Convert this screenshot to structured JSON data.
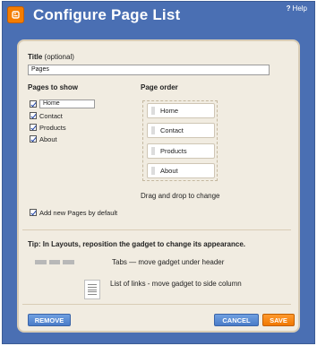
{
  "window": {
    "title": "Configure Page List",
    "help_label": "Help",
    "help_icon": "?",
    "logo_icon": "blogger-icon"
  },
  "form": {
    "title_label": "Title",
    "title_optional": "(optional)",
    "title_value": "Pages",
    "pages_to_show_label": "Pages to show",
    "pages": [
      {
        "label": "Home",
        "checked": true
      },
      {
        "label": "Contact",
        "checked": true
      },
      {
        "label": "Products",
        "checked": true
      },
      {
        "label": "About",
        "checked": true
      }
    ],
    "page_order_label": "Page order",
    "page_order": [
      "Home",
      "Contact",
      "Products",
      "About"
    ],
    "drag_hint": "Drag and drop to change",
    "add_new_label": "Add new Pages by default",
    "add_new_checked": true
  },
  "tip": {
    "text": "Tip: In Layouts, reposition the gadget to change its appearance.",
    "tabs_desc": "Tabs — move gadget under header",
    "list_desc": "List of links - move gadget to side column"
  },
  "buttons": {
    "remove": "REMOVE",
    "cancel": "CANCEL",
    "save": "SAVE"
  },
  "colors": {
    "header_bg": "#4a6fb3",
    "panel_bg": "#f1ece1",
    "save_button": "#f07800",
    "action_button": "#4a7bc8"
  }
}
